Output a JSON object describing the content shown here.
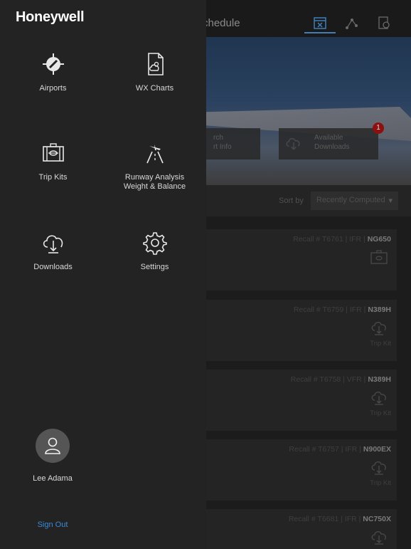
{
  "app": {
    "title_partial": "chedule",
    "hero": {
      "search_card": "rch\nrt Info",
      "downloads_card": "Available\nDownloads",
      "downloads_badge": "1"
    },
    "sort": {
      "label": "Sort by",
      "selected": "Recently Computed"
    },
    "plans": [
      {
        "recall": "Recall # T6761 | IFR | ",
        "tail": "NG650",
        "icon": "trip-kit-icon",
        "action": ""
      },
      {
        "recall": "Recall # T6759 | IFR | ",
        "tail": "N389H",
        "icon": "cloud-download-icon",
        "action": "Trip Kit"
      },
      {
        "recall": "Recall # T6758 | VFR | ",
        "tail": "N389H",
        "icon": "cloud-download-icon",
        "action": "Trip Kit"
      },
      {
        "recall": "Recall # T6757 | IFR | ",
        "tail": "N900EX",
        "icon": "cloud-download-icon",
        "action": "Trip Kit"
      },
      {
        "recall": "Recall # T6681 | IFR | ",
        "tail": "NC750X",
        "icon": "cloud-download-icon",
        "action": ""
      }
    ]
  },
  "drawer": {
    "brand": "Honeywell",
    "menu": [
      {
        "label": "Airports",
        "icon": "airport-icon"
      },
      {
        "label": "WX Charts",
        "icon": "weather-chart-icon"
      },
      {
        "label": "Trip Kits",
        "icon": "trip-kit-icon"
      },
      {
        "label": "Runway Analysis\nWeight & Balance",
        "icon": "runway-analysis-icon"
      },
      {
        "label": "Downloads",
        "icon": "cloud-download-icon"
      },
      {
        "label": "Settings",
        "icon": "gear-icon"
      }
    ],
    "user": {
      "name": "Lee Adama",
      "avatar": "user-icon"
    },
    "sign_out": "Sign Out"
  },
  "colors": {
    "drawer_bg": "#232323",
    "accent_link": "#3b8ad6",
    "badge_red": "#8c1010"
  }
}
